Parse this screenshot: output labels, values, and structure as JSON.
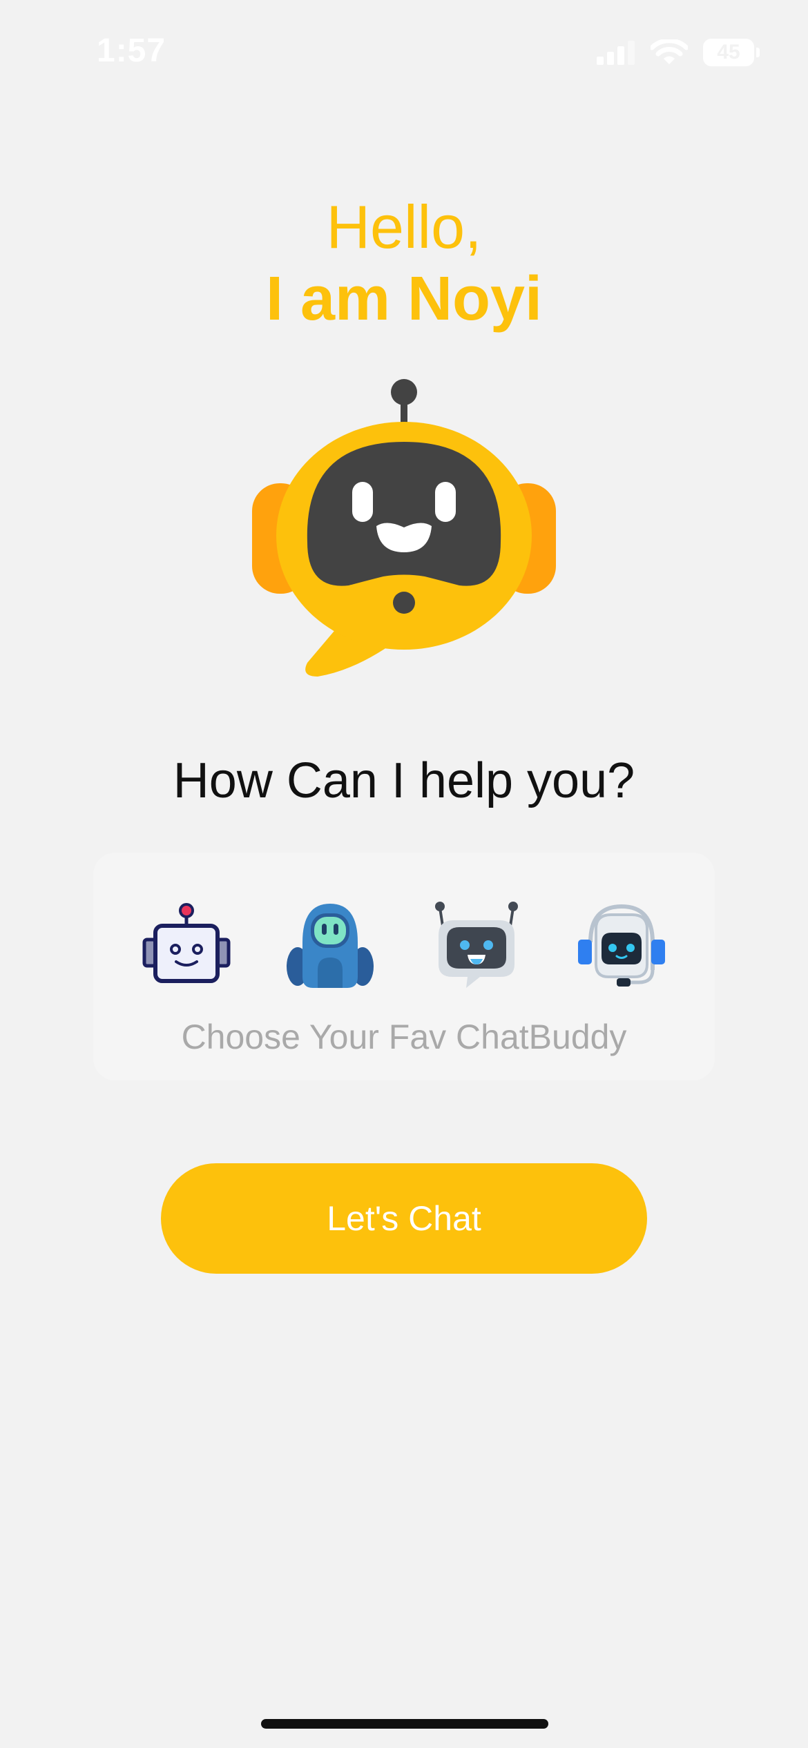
{
  "status_bar": {
    "time": "1:57",
    "battery": "45",
    "icons": [
      "signal-icon",
      "wifi-icon",
      "battery-icon"
    ]
  },
  "greeting": {
    "line1": "Hello,",
    "line2": "I am Noyi"
  },
  "mascot": {
    "icon": "robot-mascot-icon"
  },
  "help_heading": "How Can I help you?",
  "buddies": {
    "items": [
      {
        "icon": "square-robot-icon"
      },
      {
        "icon": "blue-robot-icon"
      },
      {
        "icon": "chat-bubble-robot-icon"
      },
      {
        "icon": "headset-robot-icon"
      }
    ],
    "caption": "Choose Your Fav ChatBuddy"
  },
  "cta": {
    "label": "Let's Chat"
  },
  "colors": {
    "accent": "#fdc10c",
    "accent_dark": "#ffa20d",
    "face": "#434343",
    "background": "#f2f2f2",
    "caption": "#a9a9a9"
  }
}
